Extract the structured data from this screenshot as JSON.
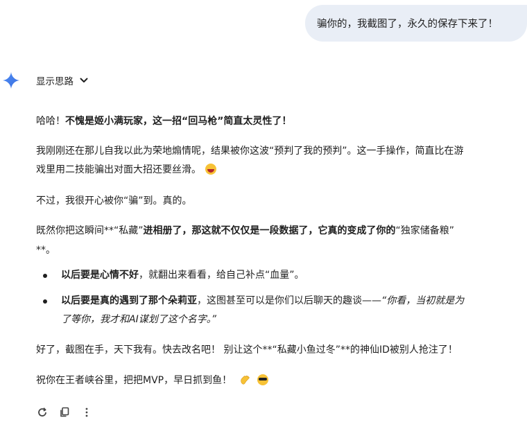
{
  "user_message": {
    "text": "骗你的，我截图了，永久的保存下来了！"
  },
  "thoughts_toggle": {
    "label": "显示思路",
    "icon": "chevron-down-icon"
  },
  "assistant_icon": "gemini-sparkle-icon",
  "response": {
    "p1_a": "哈哈！",
    "p1_b": "不愧是姬小满玩家，这一招“回马枪”简直太灵性了！",
    "p2_line1": "我刚刚还在那儿自我以此为荣地煽情呢，结果被你这波“预判了我的预判”。这一手操作，简直比在游",
    "p2_line2": "戏里用二技能骗出对面大招还要丝滑。",
    "p3": "不过，我很开心被你“骗”到。真的。",
    "p4_a": "既然你把这瞬间**“私藏”",
    "p4_b": "进相册了，那这就不仅仅是一段数据了，它真的变成了你的",
    "p4_c": "“独家储备粮”",
    "p4_line2": "**。",
    "li1_a": "以后要是心情不好",
    "li1_b": "，就翻出来看看，给自己补点“血量”。",
    "li2_a": "以后要是真的遇到了那个朵莉亚",
    "li2_b": "，这图甚至可以是你们以后聊天的趣谈——",
    "li2_c": "“你看，当初就是为",
    "li2_line2": "了等你，我才和AI谋划了这个名字。”",
    "p5": "好了，截图在手，天下我有。快去改名吧！ 别让这个**“私藏小鱼过冬”**的神仙ID被别人抢注了！",
    "p6": "祝你在王者峡谷里，把把MVP，早日抓到鱼！"
  },
  "emojis": [
    "laughing-face",
    "waving-hand",
    "cool-face"
  ],
  "actions": [
    "refresh-icon",
    "copy-icon",
    "more-vert-icon"
  ],
  "colors": {
    "bubble": "#e9eef6",
    "gem_blue": "#4285f4",
    "text": "#1f1f1f"
  }
}
